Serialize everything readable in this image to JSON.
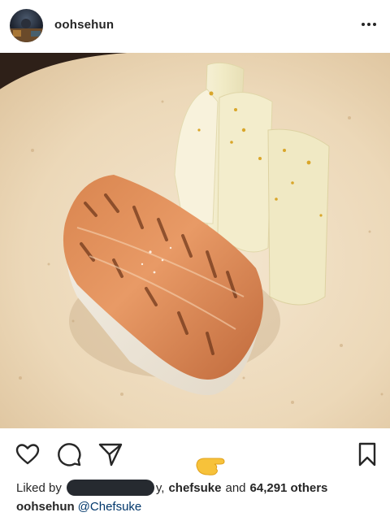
{
  "post": {
    "username": "oohsehun",
    "caption_mention": "@Chefsuke"
  },
  "likes": {
    "liked_by_prefix": "Liked by",
    "partial_tail": "y,",
    "friend": "chefsuke",
    "and_text": "and",
    "count": "64,291 others"
  },
  "icons": {
    "more": "more-dots-icon",
    "like": "heart-icon",
    "comment": "comment-bubble-icon",
    "share": "paper-plane-icon",
    "save": "bookmark-icon",
    "emoji": "pointing-hand-emoji-icon"
  },
  "colors": {
    "text": "#262626",
    "mention": "#00376b",
    "redaction": "#262a30"
  }
}
